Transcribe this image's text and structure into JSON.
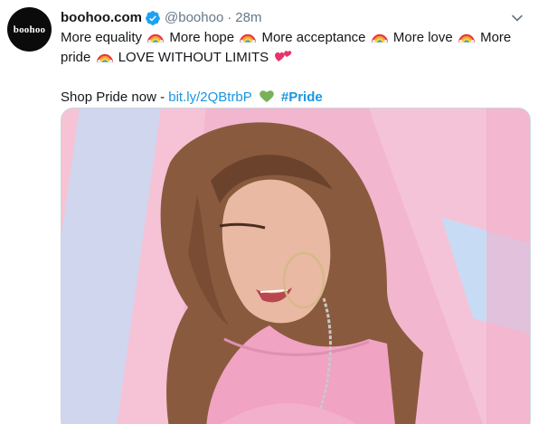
{
  "tweet": {
    "avatar": {
      "text": "boohoo"
    },
    "display_name": "boohoo.com",
    "handle": "@boohoo",
    "separator": "·",
    "time": "28m",
    "text": {
      "segments": [
        "More equality",
        "More hope",
        "More acceptance",
        "More love",
        "More",
        "pride",
        "LOVE WITHOUT LIMITS"
      ],
      "shop_prefix": "Shop Pride now -",
      "link": "bit.ly/2QBtrbP",
      "hashtag": "#Pride"
    },
    "icons": {
      "verified": "verified-badge-icon",
      "caret": "chevron-down-icon",
      "rainbow": "rainbow-emoji-icon",
      "hearts": "two-hearts-emoji-icon",
      "green_heart": "green-heart-emoji-icon"
    },
    "colors": {
      "link": "#1b95e0",
      "muted": "#657786",
      "verified": "#1da1f2",
      "media_bg_pink": "#f3b6cf",
      "media_bg_blue": "#c9d9f2"
    }
  }
}
